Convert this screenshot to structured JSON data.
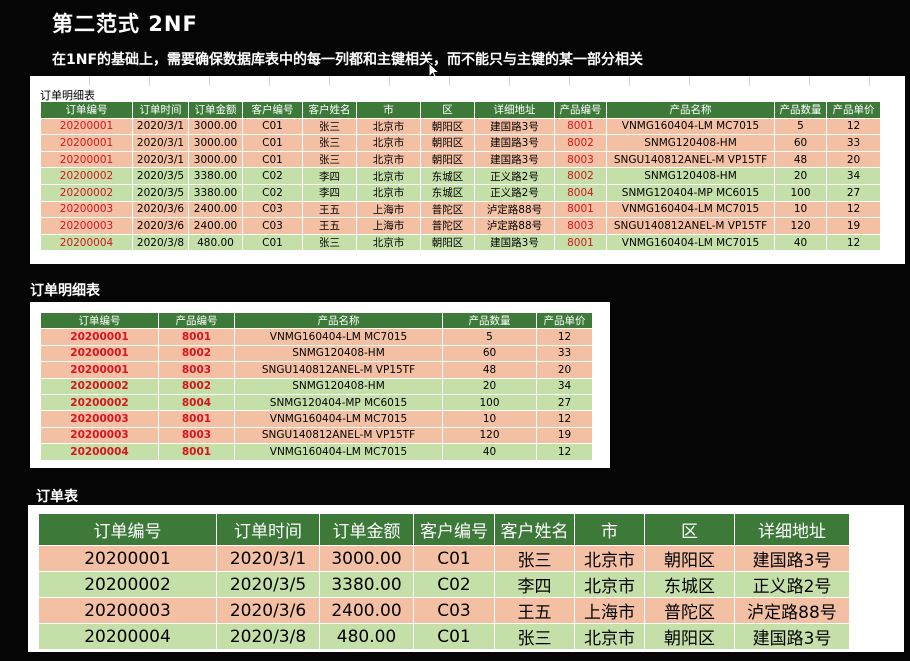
{
  "title": "第二范式 2NF",
  "subtitle": "在1NF的基础上，需要确保数据库表中的每一列都和主键相关，而不能只与主键的某一部分相关",
  "colors": {
    "header_green": "#3d7a3a",
    "row_salmon": "#f4c0a4",
    "row_green": "#c5dfa8",
    "key_red": "#d8141f"
  },
  "sheet1": {
    "caption": "订单明细表",
    "headers": [
      "订单编号",
      "订单时间",
      "订单金额",
      "客户编号",
      "客户姓名",
      "市",
      "区",
      "详细地址",
      "产品编号",
      "产品名称",
      "产品数量",
      "产品单价"
    ],
    "rows": [
      [
        "20200001",
        "2020/3/1",
        "3000.00",
        "C01",
        "张三",
        "北京市",
        "朝阳区",
        "建国路3号",
        "8001",
        "VNMG160404-LM MC7015",
        "5",
        "12"
      ],
      [
        "20200001",
        "2020/3/1",
        "3000.00",
        "C01",
        "张三",
        "北京市",
        "朝阳区",
        "建国路3号",
        "8002",
        "SNMG120408-HM",
        "60",
        "33"
      ],
      [
        "20200001",
        "2020/3/1",
        "3000.00",
        "C01",
        "张三",
        "北京市",
        "朝阳区",
        "建国路3号",
        "8003",
        "SNGU140812ANEL-M VP15TF",
        "48",
        "20"
      ],
      [
        "20200002",
        "2020/3/5",
        "3380.00",
        "C02",
        "李四",
        "北京市",
        "东城区",
        "正义路2号",
        "8002",
        "SNMG120408-HM",
        "20",
        "34"
      ],
      [
        "20200002",
        "2020/3/5",
        "3380.00",
        "C02",
        "李四",
        "北京市",
        "东城区",
        "正义路2号",
        "8004",
        "SNMG120404-MP MC6015",
        "100",
        "27"
      ],
      [
        "20200003",
        "2020/3/6",
        "2400.00",
        "C03",
        "王五",
        "上海市",
        "普陀区",
        "泸定路88号",
        "8001",
        "VNMG160404-LM MC7015",
        "10",
        "12"
      ],
      [
        "20200003",
        "2020/3/6",
        "2400.00",
        "C03",
        "王五",
        "上海市",
        "普陀区",
        "泸定路88号",
        "8003",
        "SNGU140812ANEL-M VP15TF",
        "120",
        "19"
      ],
      [
        "20200004",
        "2020/3/8",
        "480.00",
        "C01",
        "张三",
        "北京市",
        "朝阳区",
        "建国路3号",
        "8001",
        "VNMG160404-LM MC7015",
        "40",
        "12"
      ]
    ]
  },
  "section2_label": "订单明细表",
  "sheet2": {
    "headers": [
      "订单编号",
      "产品编号",
      "产品名称",
      "产品数量",
      "产品单价"
    ],
    "rows": [
      [
        "20200001",
        "8001",
        "VNMG160404-LM MC7015",
        "5",
        "12"
      ],
      [
        "20200001",
        "8002",
        "SNMG120408-HM",
        "60",
        "33"
      ],
      [
        "20200001",
        "8003",
        "SNGU140812ANEL-M VP15TF",
        "48",
        "20"
      ],
      [
        "20200002",
        "8002",
        "SNMG120408-HM",
        "20",
        "34"
      ],
      [
        "20200002",
        "8004",
        "SNMG120404-MP MC6015",
        "100",
        "27"
      ],
      [
        "20200003",
        "8001",
        "VNMG160404-LM MC7015",
        "10",
        "12"
      ],
      [
        "20200003",
        "8003",
        "SNGU140812ANEL-M VP15TF",
        "120",
        "19"
      ],
      [
        "20200004",
        "8001",
        "VNMG160404-LM MC7015",
        "40",
        "12"
      ]
    ]
  },
  "section3_label": "订单表",
  "sheet3": {
    "headers": [
      "订单编号",
      "订单时间",
      "订单金额",
      "客户编号",
      "客户姓名",
      "市",
      "区",
      "详细地址"
    ],
    "rows": [
      [
        "20200001",
        "2020/3/1",
        "3000.00",
        "C01",
        "张三",
        "北京市",
        "朝阳区",
        "建国路3号"
      ],
      [
        "20200002",
        "2020/3/5",
        "3380.00",
        "C02",
        "李四",
        "北京市",
        "东城区",
        "正义路2号"
      ],
      [
        "20200003",
        "2020/3/6",
        "2400.00",
        "C03",
        "王五",
        "上海市",
        "普陀区",
        "泸定路88号"
      ],
      [
        "20200004",
        "2020/3/8",
        "480.00",
        "C01",
        "张三",
        "北京市",
        "朝阳区",
        "建国路3号"
      ]
    ]
  }
}
